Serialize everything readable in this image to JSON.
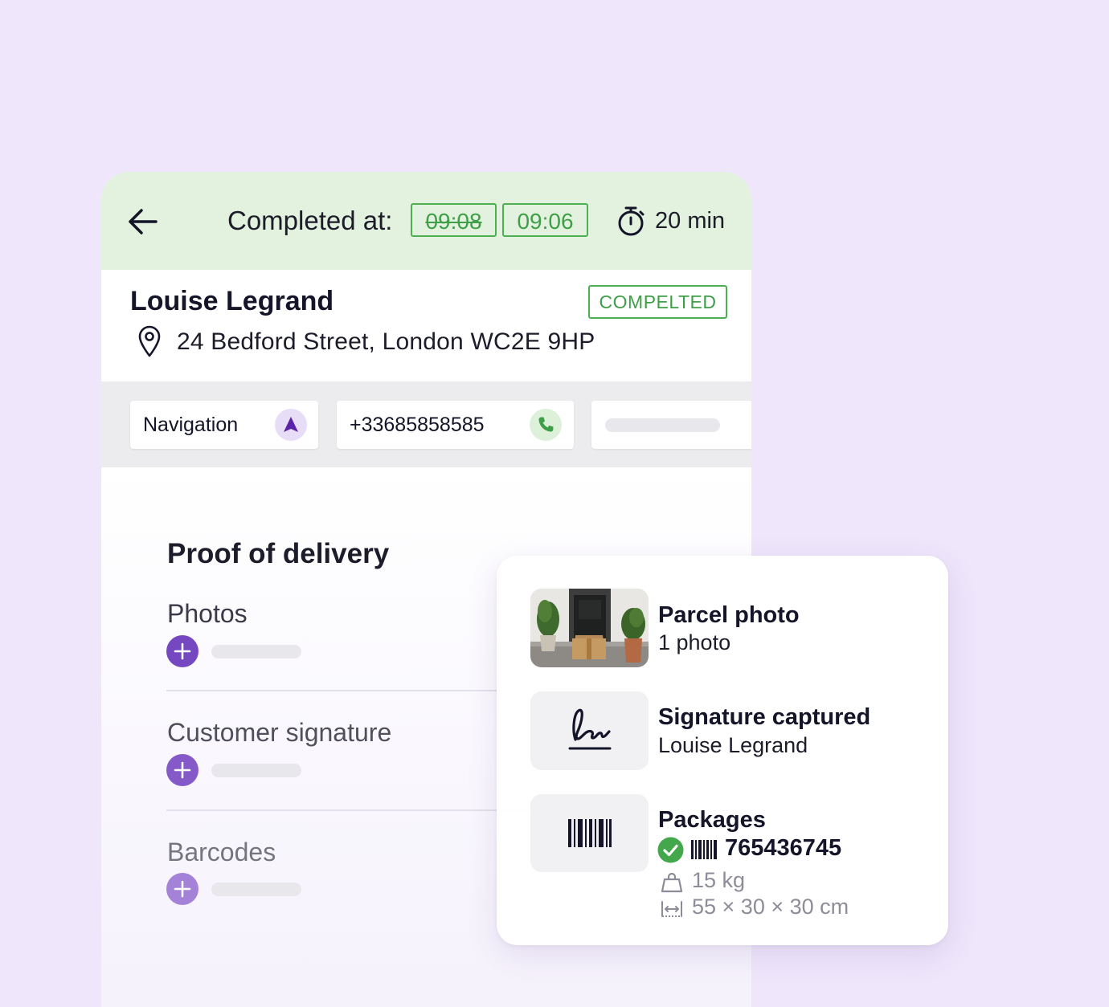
{
  "header": {
    "completed_label": "Completed at:",
    "original_time": "09:08",
    "actual_time": "09:06",
    "duration": "20 min",
    "colors": {
      "background": "#e3f2de",
      "accent_green": "#4caf50"
    }
  },
  "stop": {
    "customer_name": "Louise Legrand",
    "status": "COMPELTED",
    "address": "24 Bedford Street, London WC2E 9HP"
  },
  "actions": {
    "navigation_label": "Navigation",
    "phone_number": "+33685858585"
  },
  "proof_of_delivery": {
    "title": "Proof of delivery",
    "sections": [
      {
        "label": "Photos"
      },
      {
        "label": "Customer signature"
      },
      {
        "label": "Barcodes"
      }
    ],
    "accent_color": "#7c4fc4"
  },
  "summary_card": {
    "items": [
      {
        "title": "Parcel photo",
        "subtitle": "1 photo",
        "icon": "parcel-photo-thumbnail"
      },
      {
        "title": "Signature captured",
        "subtitle": "Louise Legrand",
        "icon": "signature-icon"
      },
      {
        "title": "Packages",
        "icon": "barcode-icon",
        "barcode": "765436745",
        "weight": "15 kg",
        "dimensions": "55 × 30 × 30 cm"
      }
    ]
  }
}
